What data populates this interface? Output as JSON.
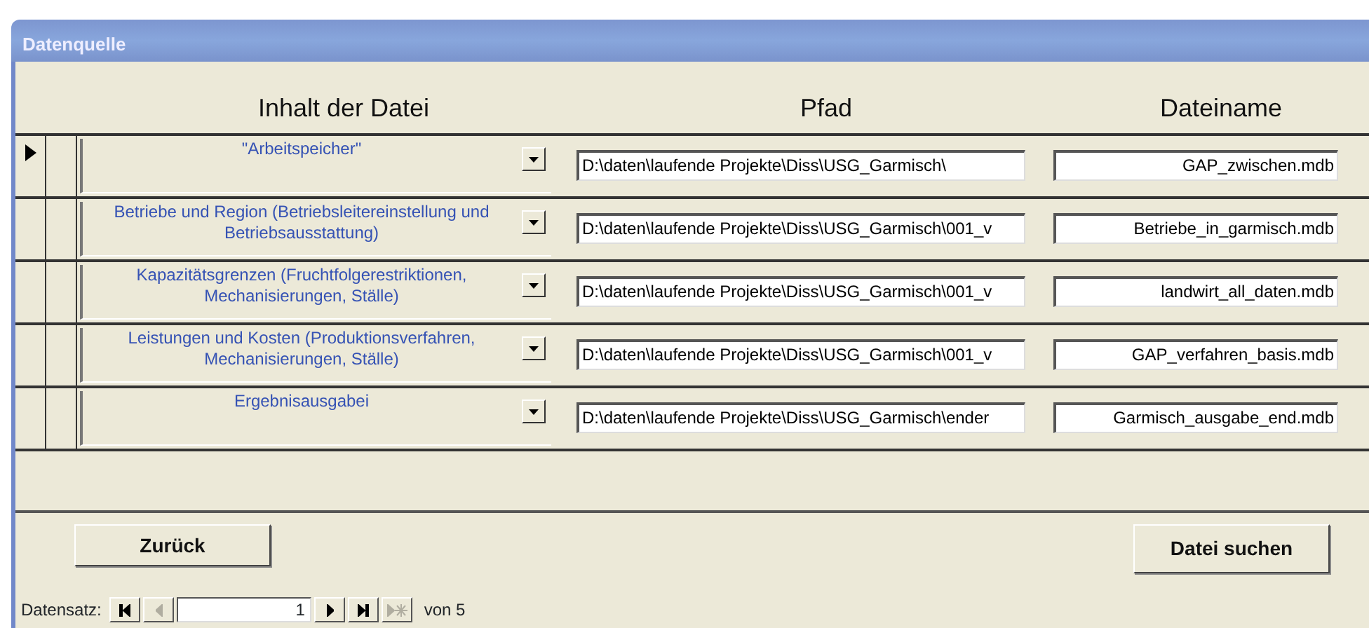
{
  "window": {
    "title": "Datenquelle"
  },
  "columns": [
    "Inhalt der Datei",
    "Pfad",
    "Dateiname"
  ],
  "rows": [
    {
      "current": true,
      "content": "\"Arbeitspeicher\"",
      "path": "D:\\daten\\laufende Projekte\\Diss\\USG_Garmisch\\",
      "filename": "GAP_zwischen.mdb"
    },
    {
      "current": false,
      "content": "Betriebe und Region (Betriebsleitereinstellung und Betriebsausstattung)",
      "path": "D:\\daten\\laufende Projekte\\Diss\\USG_Garmisch\\001_v",
      "filename": "Betriebe_in_garmisch.mdb"
    },
    {
      "current": false,
      "content": "Kapazitätsgrenzen (Fruchtfolgerestriktionen, Mechanisierungen, Ställe)",
      "path": "D:\\daten\\laufende Projekte\\Diss\\USG_Garmisch\\001_v",
      "filename": "landwirt_all_daten.mdb"
    },
    {
      "current": false,
      "content": "Leistungen und Kosten (Produktionsverfahren, Mechanisierungen, Ställe)",
      "path": "D:\\daten\\laufende Projekte\\Diss\\USG_Garmisch\\001_v",
      "filename": "GAP_verfahren_basis.mdb"
    },
    {
      "current": false,
      "content": "Ergebnisausgabei",
      "path": "D:\\daten\\laufende Projekte\\Diss\\USG_Garmisch\\ender",
      "filename": "Garmisch_ausgabe_end.mdb"
    }
  ],
  "buttons": {
    "back": "Zurück",
    "search": "Datei suchen"
  },
  "navigator": {
    "label": "Datensatz:",
    "record": "1",
    "count": "von 5",
    "controls": [
      {
        "kind": "first",
        "disabled": false
      },
      {
        "kind": "prev",
        "disabled": true
      },
      {
        "kind": "field"
      },
      {
        "kind": "next",
        "disabled": false
      },
      {
        "kind": "last",
        "disabled": false
      },
      {
        "kind": "new",
        "disabled": true
      }
    ]
  }
}
